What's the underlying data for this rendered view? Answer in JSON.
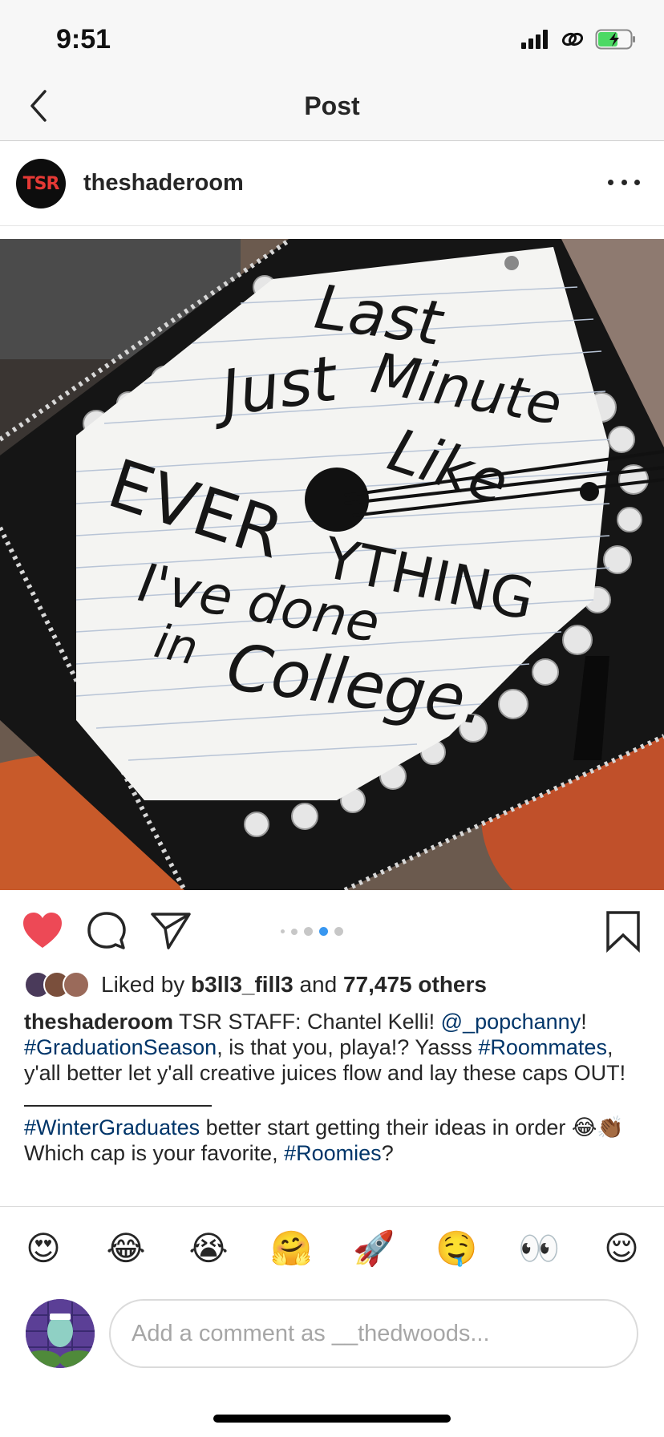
{
  "status_bar": {
    "time": "9:51"
  },
  "nav": {
    "title": "Post"
  },
  "post": {
    "avatar_text": "TSR",
    "username": "theshaderoom",
    "photo_text": {
      "line1": "Last",
      "line2": "Minute",
      "line3": "Just",
      "line4": "Like",
      "line5a": "EVER",
      "line5b": "YTHING",
      "line6": "I've done",
      "line7": "in",
      "line8": "College."
    },
    "carousel": {
      "count": 5,
      "active_index": 3
    },
    "liked": true
  },
  "likes": {
    "prefix": "Liked by ",
    "user": "b3ll3_fill3",
    "middle": " and ",
    "others": "77,475 others"
  },
  "caption": {
    "username": "theshaderoom",
    "text1": " TSR STAFF: Chantel Kelli! ",
    "mention": "@_popchanny",
    "text2": "!",
    "tag1": "#GraduationSeason",
    "text3": ", is that you, playa!? Yasss ",
    "tag2": "#Roommates",
    "text4": ", y'all better let y'all creative juices flow and lay these caps OUT!",
    "tag3": "#WinterGraduates",
    "text5": " better start getting their ideas in order ",
    "emoji1": "😂",
    "emoji2": "👏🏾",
    "text6": " Which cap is your favorite, ",
    "tag4": "#Roomies",
    "text7": "?"
  },
  "emoji_bar": [
    "😍",
    "😂",
    "😭",
    "🤗",
    "🚀",
    "🤤",
    "👀",
    "😌"
  ],
  "comment": {
    "placeholder": "Add a comment as __thedwoods..."
  },
  "colors": {
    "heart": "#ed4956",
    "hashtag": "#003569",
    "carousel_active": "#3897f0"
  },
  "icons": {
    "back": "chevron-left-icon",
    "more": "more-horizontal-icon",
    "like": "heart-filled-icon",
    "comment": "comment-bubble-icon",
    "share": "paper-plane-icon",
    "save": "bookmark-icon"
  }
}
